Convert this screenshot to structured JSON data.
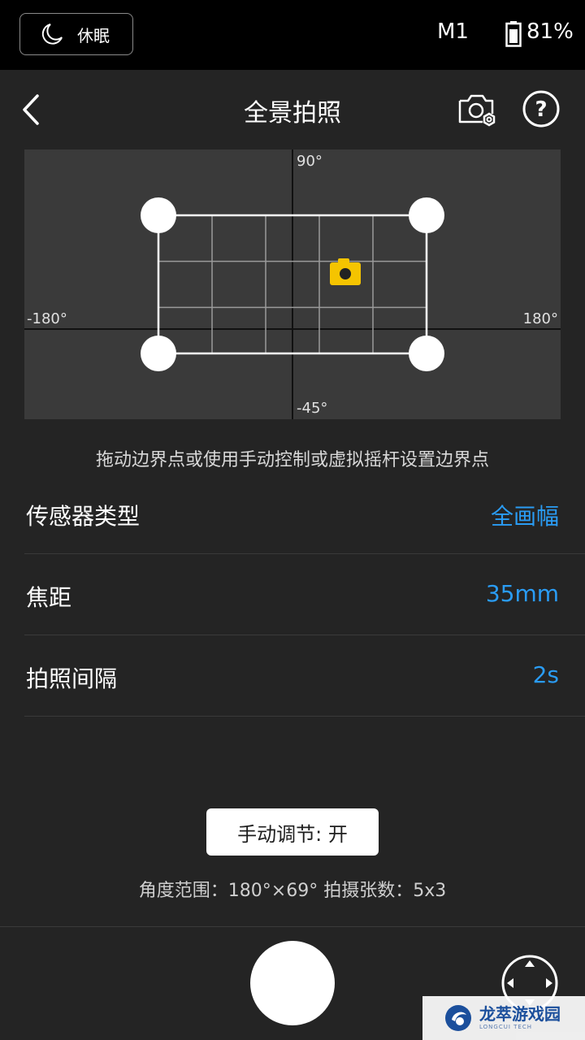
{
  "status_bar": {
    "sleep_label": "休眠",
    "mode": "M1",
    "battery_percent": "81%",
    "battery_level": 0.81
  },
  "header": {
    "title": "全景拍照"
  },
  "panorama": {
    "top_label": "90°",
    "bottom_label": "-45°",
    "left_label": "-180°",
    "right_label": "180°",
    "grid_columns": 5,
    "grid_rows": 3,
    "accent_color": "#f5c400"
  },
  "hint": "拖动边界点或使用手动控制或虚拟摇杆设置边界点",
  "settings": [
    {
      "label": "传感器类型",
      "value": "全画幅"
    },
    {
      "label": "焦距",
      "value": "35mm"
    },
    {
      "label": "拍照间隔",
      "value": "2s"
    }
  ],
  "manual_button": "手动调节: 开",
  "info": "角度范围：180°×69°   拍摄张数：5x3",
  "watermark": {
    "cn": "龙萃游戏园",
    "en": "LONGCUI TECH"
  },
  "colors": {
    "value_blue": "#2a9cf4",
    "background": "#242424",
    "status_bar": "#000000"
  }
}
